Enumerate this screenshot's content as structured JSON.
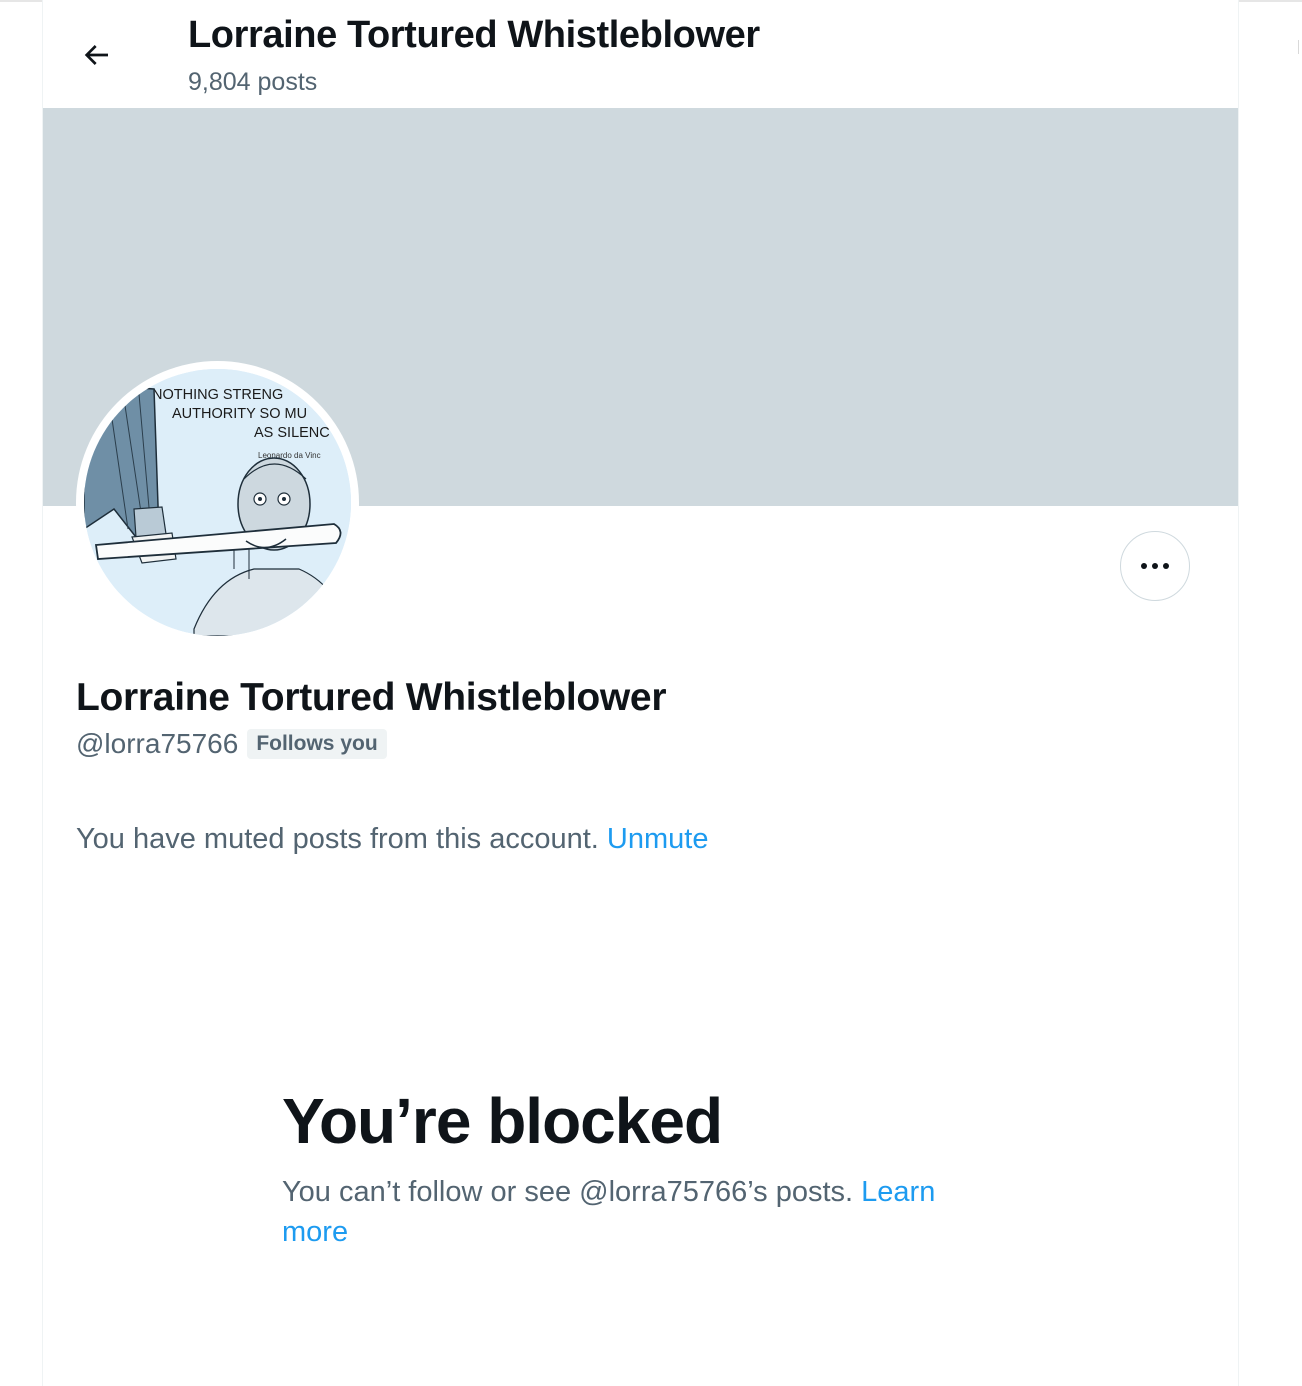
{
  "header": {
    "title": "Lorraine Tortured Whistleblower",
    "post_count": "9,804 posts",
    "back_icon": "arrow-left-icon"
  },
  "avatar": {
    "quote_line1": "NOTHING STRENG",
    "quote_line2": "AUTHORITY SO MU",
    "quote_line3": "AS SILENC",
    "quote_author": "Leonardo da Vinc"
  },
  "profile": {
    "display_name": "Lorraine Tortured Whistleblower",
    "handle": "@lorra75766",
    "follows_badge": "Follows you",
    "more_icon": "more-options-icon"
  },
  "muted": {
    "text": "You have muted posts from this account.",
    "unmute_label": "Unmute"
  },
  "blocked": {
    "title": "You’re blocked",
    "description": "You can’t follow or see @lorra75766’s posts.",
    "learn_more_label": "Learn more"
  },
  "colors": {
    "accent": "#1d9bf0",
    "banner": "#cfd9de",
    "secondary_text": "#536471",
    "primary_text": "#0f1419"
  }
}
